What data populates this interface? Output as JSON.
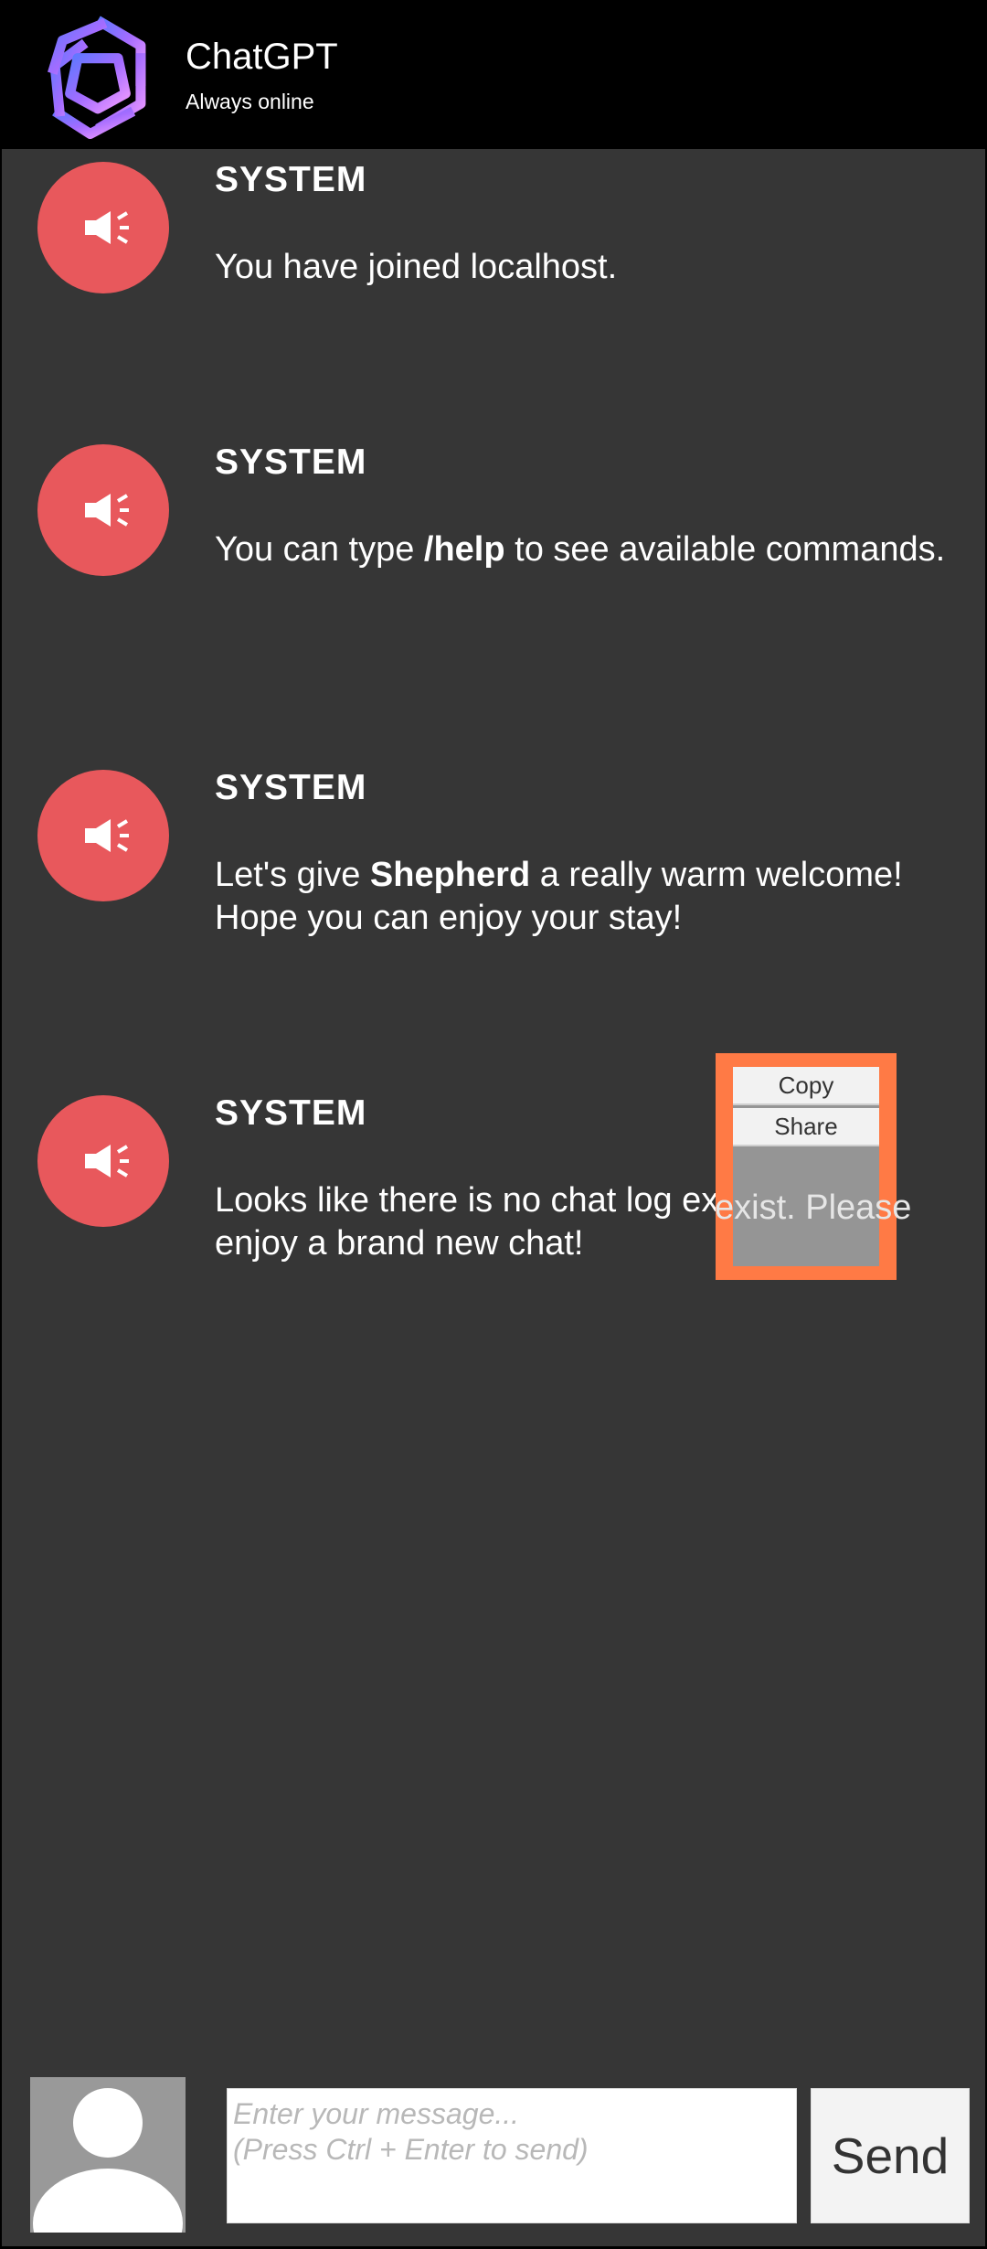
{
  "header": {
    "title": "ChatGPT",
    "subtitle": "Always online",
    "logo_icon": "openai-knot-icon"
  },
  "messages": [
    {
      "sender": "SYSTEM",
      "text": "You have joined localhost."
    },
    {
      "sender": "SYSTEM",
      "text_pre": "You can type ",
      "text_bold": "/help",
      "text_post": " to see available commands."
    },
    {
      "sender": "SYSTEM",
      "text_pre": "Let's give ",
      "text_bold": "Shepherd",
      "text_post": " a really warm welcome! Hope you can enjoy your stay!"
    },
    {
      "sender": "SYSTEM",
      "text": "Looks like there is no chat log exist. Please enjoy a brand new chat!"
    }
  ],
  "context_menu": {
    "items": [
      "Copy",
      "Share"
    ],
    "underlay_text": "exist. Please"
  },
  "composer": {
    "placeholder": "Enter your message...\n(Press Ctrl + Enter to send)",
    "send_label": "Send"
  },
  "colors": {
    "header_bg": "#000000",
    "chat_bg": "#363636",
    "system_avatar": "#e8585c",
    "menu_highlight": "#ff7a45"
  }
}
